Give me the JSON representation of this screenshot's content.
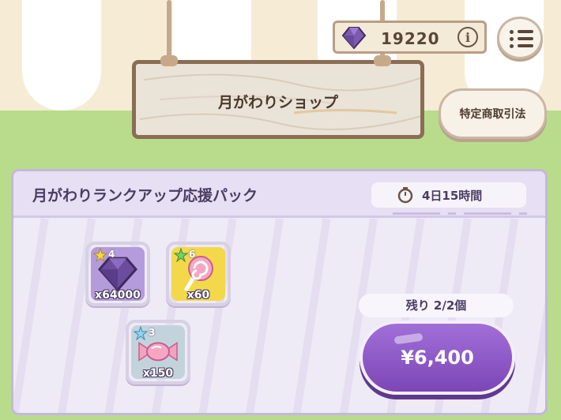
{
  "currency": {
    "icon": "gem-icon",
    "amount": "19220",
    "info_icon": "info-icon",
    "info_glyph": "i"
  },
  "menu": {
    "icon": "menu-list-icon"
  },
  "sign": {
    "title": "月がわりショップ"
  },
  "legal_button": {
    "label": "特定商取引法"
  },
  "pack": {
    "title": "月がわりランクアップ応援パック",
    "timer": {
      "icon": "stopwatch-icon",
      "text": "4日15時間"
    },
    "items": [
      {
        "name": "gem",
        "icon": "gem-icon",
        "rarity": "4",
        "quantity": "x64000",
        "color": "#b49bdc"
      },
      {
        "name": "lollipop",
        "icon": "lollipop-icon",
        "rarity": "6",
        "quantity": "x60",
        "color": "#f3d84a"
      },
      {
        "name": "candy",
        "icon": "candy-icon",
        "rarity": "3",
        "quantity": "x150",
        "color": "#c3d3dc"
      }
    ],
    "remaining": "残り 2/2個",
    "price": "¥6,400"
  },
  "colors": {
    "accent": "#8a55c6",
    "panel": "#eeeaf6",
    "wood": "#8a6d55"
  }
}
